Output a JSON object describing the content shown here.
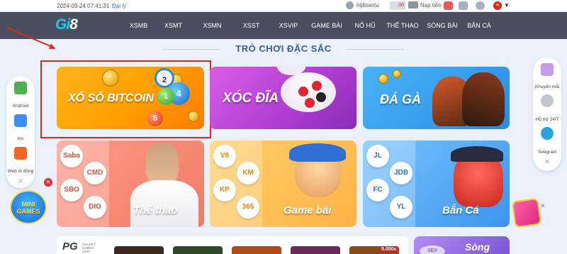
{
  "topbar": {
    "datetime": "2024-09-24 07:41:31",
    "login_link": "Đại lý",
    "username": "htjlilsertu",
    "balance": ".00",
    "deposit": "Nạp tiền",
    "flag": "★"
  },
  "nav": {
    "logo_prefix": "Gi",
    "logo_suffix": "8",
    "items": [
      "XSMB",
      "XSMT",
      "XSMN",
      "XSST",
      "XSVIP",
      "GAME BÀI",
      "NỔ HŨ",
      "THỂ THAO",
      "SÒNG BÀI",
      "BẮN CÁ"
    ]
  },
  "section": {
    "title": "TRÒ CHƠI ĐẶC SẮC"
  },
  "cards": {
    "xoso": "XỔ SỐ BITCOIN",
    "xocdia": "XÓC ĐĨA",
    "daga": "ĐÁ GÀ",
    "thethao": "Thể thao",
    "gamebai": "Game bài",
    "banca": "Bắn Cá"
  },
  "lottery_balls": [
    "2",
    "4",
    "1",
    "5"
  ],
  "thethao_providers": [
    "Saba",
    "CMD",
    "SBO",
    "DIG"
  ],
  "gamebai_providers": [
    "V8",
    "KM",
    "KP",
    "365"
  ],
  "banca_providers": [
    "JL",
    "JDB",
    "FC",
    "YL"
  ],
  "left_panel": {
    "items": [
      "Android",
      "ios",
      "Web di động"
    ],
    "close": "✕"
  },
  "minigames": {
    "line1": "MINI",
    "line2": "GAMES",
    "close": "✕"
  },
  "right_panel": {
    "items": [
      "Khuyến mãi",
      "Hỗ trợ 24/7",
      "Telegram"
    ],
    "close": "✕",
    "gift_close": "✕"
  },
  "bottom": {
    "pg_logo": "PG",
    "pg_sub": "POCKET GAMES SOFT",
    "badge": "5.000x",
    "song_label": "Sòng",
    "song_chip": "SEX"
  },
  "colors": {
    "accent_red": "#e0261f",
    "nav_bg": "#4a4f5f",
    "section_title": "#3d5d8f"
  }
}
